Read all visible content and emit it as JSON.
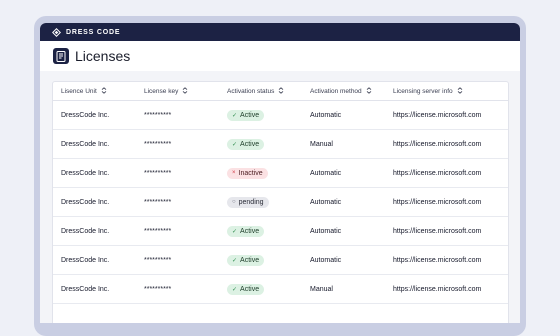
{
  "brand": {
    "name": "DRESS CODE"
  },
  "page": {
    "title": "Licenses"
  },
  "table": {
    "columns": [
      "Lisence Unit",
      "License key",
      "Activation status",
      "Activation method",
      "Licensing server info"
    ],
    "rows": [
      {
        "unit": "DressCode Inc.",
        "key": "**********",
        "status": "Active",
        "status_kind": "active",
        "method": "Automatic",
        "server": "https://license.microsoft.com"
      },
      {
        "unit": "DressCode Inc.",
        "key": "**********",
        "status": "Active",
        "status_kind": "active",
        "method": "Manual",
        "server": "https://license.microsoft.com"
      },
      {
        "unit": "DressCode Inc.",
        "key": "**********",
        "status": "Inactive",
        "status_kind": "inactive",
        "method": "Automatic",
        "server": "https://license.microsoft.com"
      },
      {
        "unit": "DressCode Inc.",
        "key": "**********",
        "status": "pending",
        "status_kind": "pending",
        "method": "Automatic",
        "server": "https://license.microsoft.com"
      },
      {
        "unit": "DressCode Inc.",
        "key": "**********",
        "status": "Active",
        "status_kind": "active",
        "method": "Automatic",
        "server": "https://license.microsoft.com"
      },
      {
        "unit": "DressCode Inc.",
        "key": "**********",
        "status": "Active",
        "status_kind": "active",
        "method": "Automatic",
        "server": "https://license.microsoft.com"
      },
      {
        "unit": "DressCode Inc.",
        "key": "**********",
        "status": "Active",
        "status_kind": "active",
        "method": "Manual",
        "server": "https://license.microsoft.com"
      }
    ]
  },
  "icons": {
    "status_active": "check-icon",
    "status_inactive": "x-icon",
    "status_pending": "circle-icon"
  },
  "colors": {
    "navbar": "#1c2244",
    "active_bg": "#dcf1e3",
    "inactive_bg": "#fbe1e3",
    "pending_bg": "#e6e7ec"
  }
}
